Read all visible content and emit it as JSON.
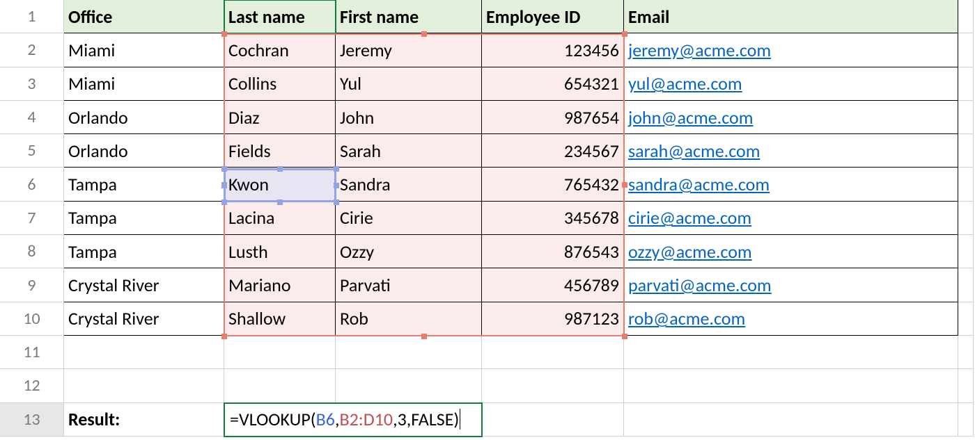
{
  "headers": {
    "A": "Office",
    "B": "Last name",
    "C": "First name",
    "D": "Employee ID",
    "E": "Email"
  },
  "row_numbers": [
    "1",
    "2",
    "3",
    "4",
    "5",
    "6",
    "7",
    "8",
    "9",
    "10",
    "11",
    "12",
    "13"
  ],
  "rows": [
    {
      "office": "Miami",
      "last": "Cochran",
      "first": "Jeremy",
      "id": "123456",
      "email": "jeremy@acme.com"
    },
    {
      "office": "Miami",
      "last": "Collins",
      "first": "Yul",
      "id": "654321",
      "email": "yul@acme.com"
    },
    {
      "office": "Orlando",
      "last": "Diaz",
      "first": "John",
      "id": "987654",
      "email": "john@acme.com"
    },
    {
      "office": "Orlando",
      "last": "Fields",
      "first": "Sarah",
      "id": "234567",
      "email": "sarah@acme.com"
    },
    {
      "office": "Tampa",
      "last": "Kwon",
      "first": "Sandra",
      "id": "765432",
      "email": "sandra@acme.com"
    },
    {
      "office": "Tampa",
      "last": "Lacina",
      "first": "Cirie",
      "id": "345678",
      "email": "cirie@acme.com"
    },
    {
      "office": "Tampa",
      "last": "Lusth",
      "first": "Ozzy",
      "id": "876543",
      "email": "ozzy@acme.com"
    },
    {
      "office": "Crystal River",
      "last": "Mariano",
      "first": "Parvati",
      "id": "456789",
      "email": "parvati@acme.com"
    },
    {
      "office": "Crystal River",
      "last": "Shallow",
      "first": "Rob",
      "id": "987123",
      "email": "rob@acme.com"
    }
  ],
  "result_label": "Result:",
  "formula": {
    "raw": "=VLOOKUP(B6,B2:D10,3,FALSE)",
    "tokens": {
      "eq": "=",
      "fn": "VLOOKUP",
      "lp": "(",
      "ref1": "B6",
      "c1": ",",
      "ref2": "B2:D10",
      "c2": ",",
      "arg3": "3",
      "c3": ",",
      "arg4": "FALSE",
      "rp": ")"
    }
  },
  "chart_data": {
    "type": "table",
    "title": "Employee directory with VLOOKUP formula",
    "columns": [
      "Office",
      "Last name",
      "First name",
      "Employee ID",
      "Email"
    ],
    "rows": [
      [
        "Miami",
        "Cochran",
        "Jeremy",
        123456,
        "jeremy@acme.com"
      ],
      [
        "Miami",
        "Collins",
        "Yul",
        654321,
        "yul@acme.com"
      ],
      [
        "Orlando",
        "Diaz",
        "John",
        987654,
        "john@acme.com"
      ],
      [
        "Orlando",
        "Fields",
        "Sarah",
        234567,
        "sarah@acme.com"
      ],
      [
        "Tampa",
        "Kwon",
        "Sandra",
        765432,
        "sandra@acme.com"
      ],
      [
        "Tampa",
        "Lacina",
        "Cirie",
        345678,
        "cirie@acme.com"
      ],
      [
        "Tampa",
        "Lusth",
        "Ozzy",
        876543,
        "ozzy@acme.com"
      ],
      [
        "Crystal River",
        "Mariano",
        "Parvati",
        456789,
        "parvati@acme.com"
      ],
      [
        "Crystal River",
        "Shallow",
        "Rob",
        987123,
        "rob@acme.com"
      ]
    ],
    "formula_cell": {
      "cell": "B13",
      "formula": "=VLOOKUP(B6,B2:D10,3,FALSE)"
    },
    "highlights": {
      "lookup_value": "B6",
      "table_array": "B2:D10",
      "col_index": 3,
      "range_lookup": false
    }
  }
}
